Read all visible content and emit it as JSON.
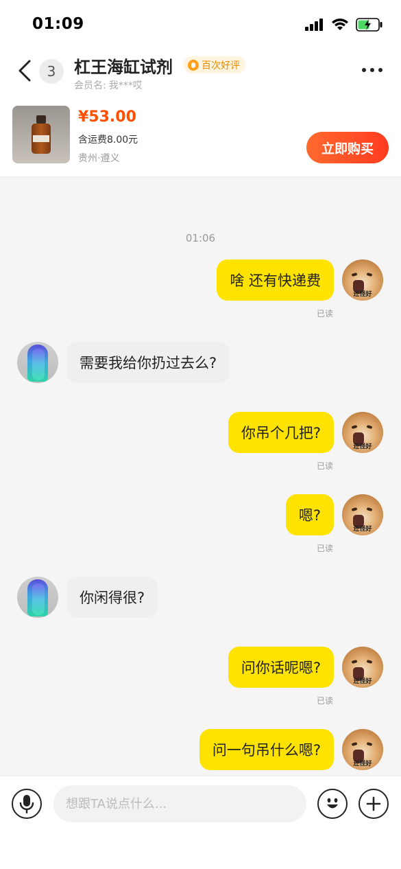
{
  "status_bar": {
    "time": "01:09"
  },
  "header": {
    "unread_count": "3",
    "shop_title": "杠王海缸试剂",
    "review_badge": "百次好评",
    "member_label": "会员名:",
    "member_name": "我***哎",
    "product": {
      "price": "¥53.00",
      "shipping": "含运费8.00元",
      "location": "贵州·遵义",
      "buy_label": "立即购买"
    }
  },
  "chat": {
    "timestamp": "01:06",
    "avatar_caption": "还怪好",
    "messages": [
      {
        "direction": "out",
        "text": "啥 还有快递费",
        "status": "已读"
      },
      {
        "direction": "in",
        "text": "需要我给你扔过去么?"
      },
      {
        "direction": "out",
        "text": "你吊个几把?",
        "status": "已读"
      },
      {
        "direction": "out",
        "text": "嗯?",
        "status": "已读"
      },
      {
        "direction": "in",
        "text": "你闲得很?"
      },
      {
        "direction": "out",
        "text": "问你话呢嗯?",
        "status": "已读"
      },
      {
        "direction": "out",
        "text": "问一句吊什么嗯?"
      }
    ]
  },
  "input_bar": {
    "placeholder": "想跟TA说点什么..."
  },
  "colors": {
    "accent": "#ff5000",
    "bubble_out": "#ffe300",
    "bubble_in": "#efefef"
  }
}
